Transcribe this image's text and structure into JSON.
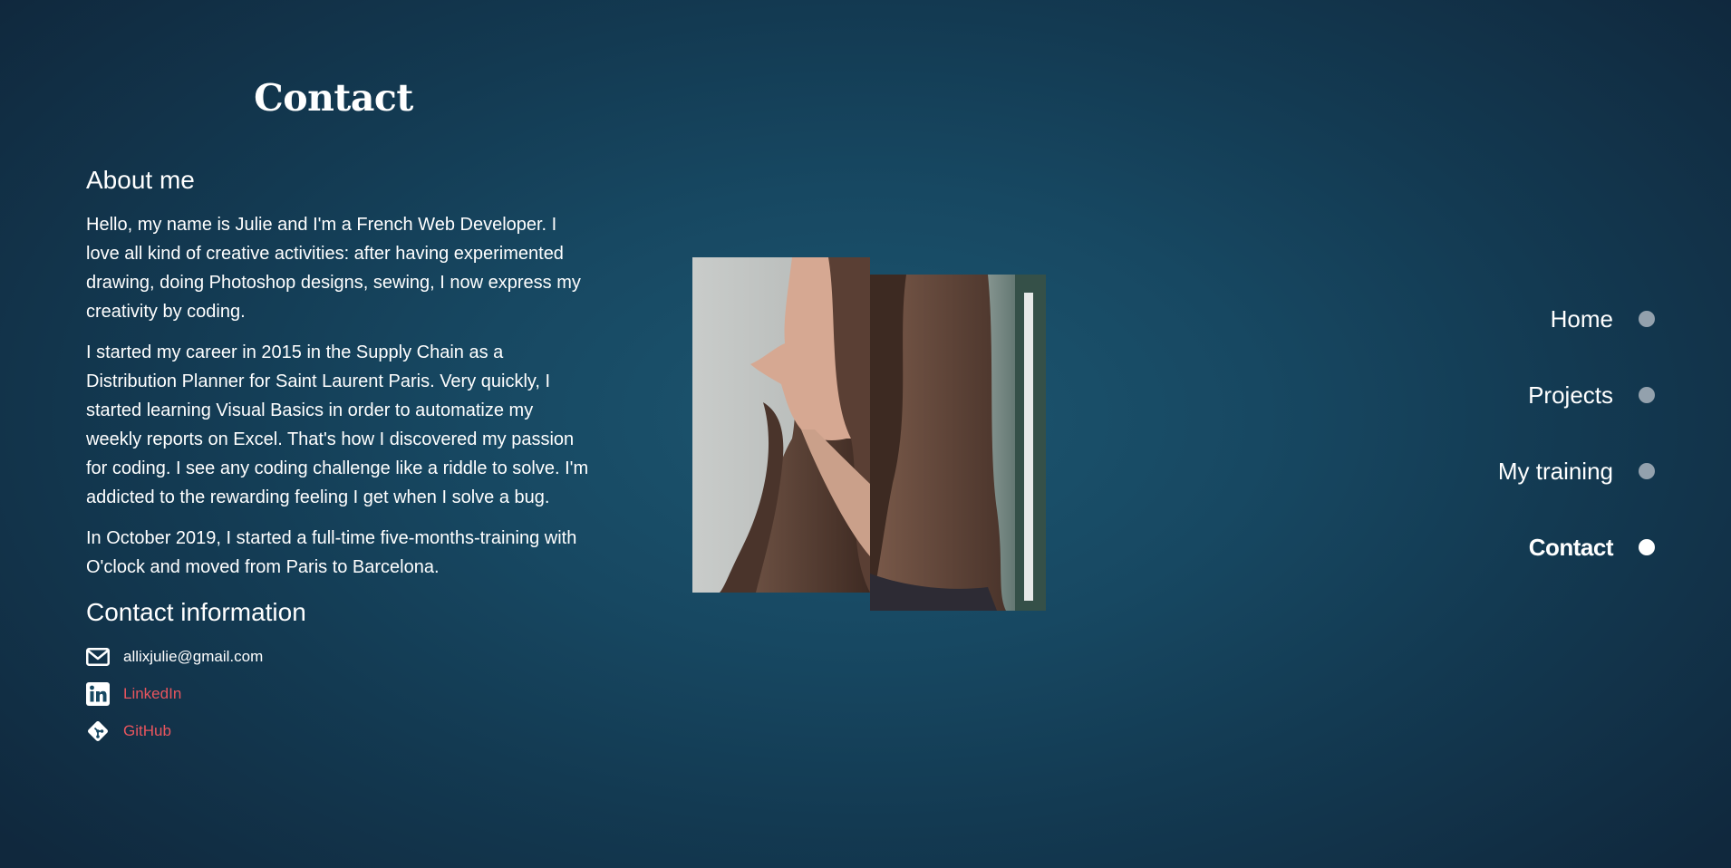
{
  "page": {
    "title": "Contact"
  },
  "about": {
    "heading": "About me",
    "paragraphs": [
      "Hello, my name is Julie and I'm a French Web Developer. I love all kind of creative activities: after having experimented drawing, doing Photoshop designs, sewing, I now express my creativity by coding.",
      "I started my career in 2015 in the Supply Chain as a Distribution Planner for Saint Laurent Paris. Very quickly, I started learning Visual Basics in order to automatize my weekly reports on Excel. That's how I discovered my passion for coding. I see any coding challenge like a riddle to solve. I'm addicted to the rewarding feeling I get when I solve a bug.",
      "In October 2019, I started a full-time five-months-training with O'clock and moved from Paris to Barcelona."
    ]
  },
  "contact": {
    "heading": "Contact information",
    "items": [
      {
        "icon": "mail-icon",
        "label": "allixjulie@gmail.com"
      },
      {
        "icon": "linkedin-icon",
        "label": "LinkedIn"
      },
      {
        "icon": "git-icon",
        "label": "GitHub"
      }
    ]
  },
  "nav": {
    "items": [
      {
        "label": "Home",
        "active": false
      },
      {
        "label": "Projects",
        "active": false
      },
      {
        "label": "My training",
        "active": false
      },
      {
        "label": "Contact",
        "active": true
      }
    ]
  },
  "colors": {
    "background": "#174862",
    "link": "#e8555e",
    "nav_dot_inactive": "#93a1ad",
    "nav_dot_active": "#ffffff"
  }
}
